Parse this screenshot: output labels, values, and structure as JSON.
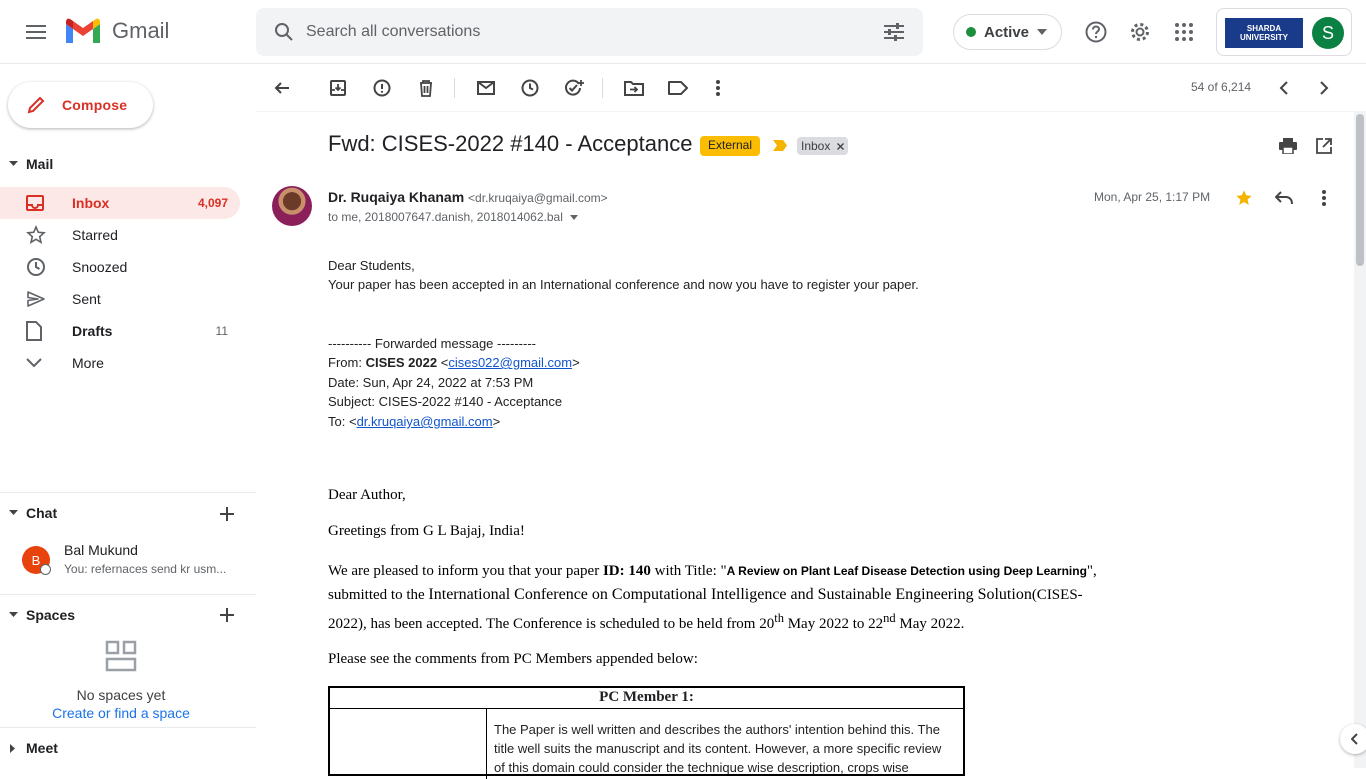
{
  "app": {
    "name": "Gmail"
  },
  "search": {
    "placeholder": "Search all conversations"
  },
  "status": {
    "label": "Active"
  },
  "account": {
    "org_logo_text": "SHARDA UNIVERSITY",
    "avatar_letter": "S"
  },
  "compose": {
    "label": "Compose"
  },
  "mail_section": {
    "title": "Mail"
  },
  "nav": [
    {
      "label": "Inbox",
      "count": "4,097"
    },
    {
      "label": "Starred",
      "count": ""
    },
    {
      "label": "Snoozed",
      "count": ""
    },
    {
      "label": "Sent",
      "count": ""
    },
    {
      "label": "Drafts",
      "count": "11"
    },
    {
      "label": "More",
      "count": ""
    }
  ],
  "chat": {
    "title": "Chat",
    "items": [
      {
        "avatar": "B",
        "name": "Bal Mukund",
        "preview": "You: refernaces send kr usm..."
      }
    ]
  },
  "spaces": {
    "title": "Spaces",
    "empty_text": "No spaces yet",
    "link": "Create or find a space"
  },
  "meet": {
    "title": "Meet"
  },
  "pager": {
    "text": "54 of 6,214"
  },
  "message": {
    "subject": "Fwd: CISES-2022 #140 - Acceptance",
    "labels": {
      "external": "External",
      "inbox": "Inbox"
    },
    "sender_name": "Dr. Ruqaiya Khanam",
    "sender_email": "<dr.kruqaiya@gmail.com>",
    "recipients": "to me, 2018007647.danish, 2018014062.bal",
    "date": "Mon, Apr 25, 1:17 PM",
    "greeting": "Dear Students,",
    "intro": "Your paper has been accepted in an International conference and now you have to register your paper.",
    "fwd_header": "---------- Forwarded message ---------",
    "from_label": "From: ",
    "from_name": "CISES 2022",
    "from_email": "cises022@gmail.com",
    "date_line": "Date: Sun, Apr 24, 2022 at 7:53 PM",
    "subject_line": "Subject: CISES-2022 #140 - Acceptance",
    "to_label": "To: ",
    "to_email": "dr.kruqaiya@gmail.com",
    "dear_author": "Dear Author,",
    "greetings": "Greetings from G L Bajaj, India!",
    "para": {
      "p1": "We are pleased to inform you that your paper ",
      "id": "ID: 140",
      "p2": "  with Title: \"",
      "title": "A Review on Plant Leaf Disease Detection using Deep Learning",
      "p3": "\", submitted to the ",
      "conf": "International Conference on Computational Intelligence and Sustainable Engineering Solution",
      "p4": "(CISES-2022), has been accepted. The Conference is scheduled to be held from 20",
      "sup1": "th",
      "p5": " May 2022 to 22",
      "sup2": "nd",
      "p6": " May 2022."
    },
    "comments_intro": "Please see the comments from PC Members appended below:",
    "table_head": "PC Member 1:",
    "review": "The Paper is well written and describes the authors' intention behind this. The title well suits the manuscript and its content. However, a more specific review of this domain could consider the technique wise description, crops wise"
  }
}
